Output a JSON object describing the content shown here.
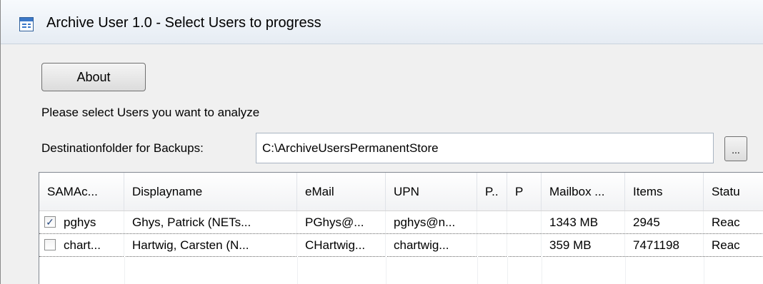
{
  "window": {
    "title": "Archive User 1.0 - Select Users to progress"
  },
  "about_button": {
    "label": "About"
  },
  "instruction": "Please select Users you want to analyze",
  "destination": {
    "label": "Destinationfolder for Backups:",
    "value": "C:\\ArchiveUsersPermanentStore",
    "browse_label": "..."
  },
  "table": {
    "columns": [
      "SAMAc...",
      "Displayname",
      "eMail",
      "UPN",
      "P..",
      "P",
      "Mailbox ...",
      "Items",
      "Statu"
    ],
    "rows": [
      {
        "checked": true,
        "check_mark": "✓",
        "cells": [
          "pghys",
          "Ghys, Patrick (NETs...",
          "PGhys@...",
          "pghys@n...",
          "",
          "",
          "1343 MB",
          "2945",
          "Reac"
        ]
      },
      {
        "checked": false,
        "check_mark": "",
        "cells": [
          "chart...",
          "Hartwig, Carsten (N...",
          "CHartwig...",
          "chartwig...",
          "",
          "",
          "359 MB",
          "7471198",
          "Reac"
        ]
      }
    ]
  }
}
